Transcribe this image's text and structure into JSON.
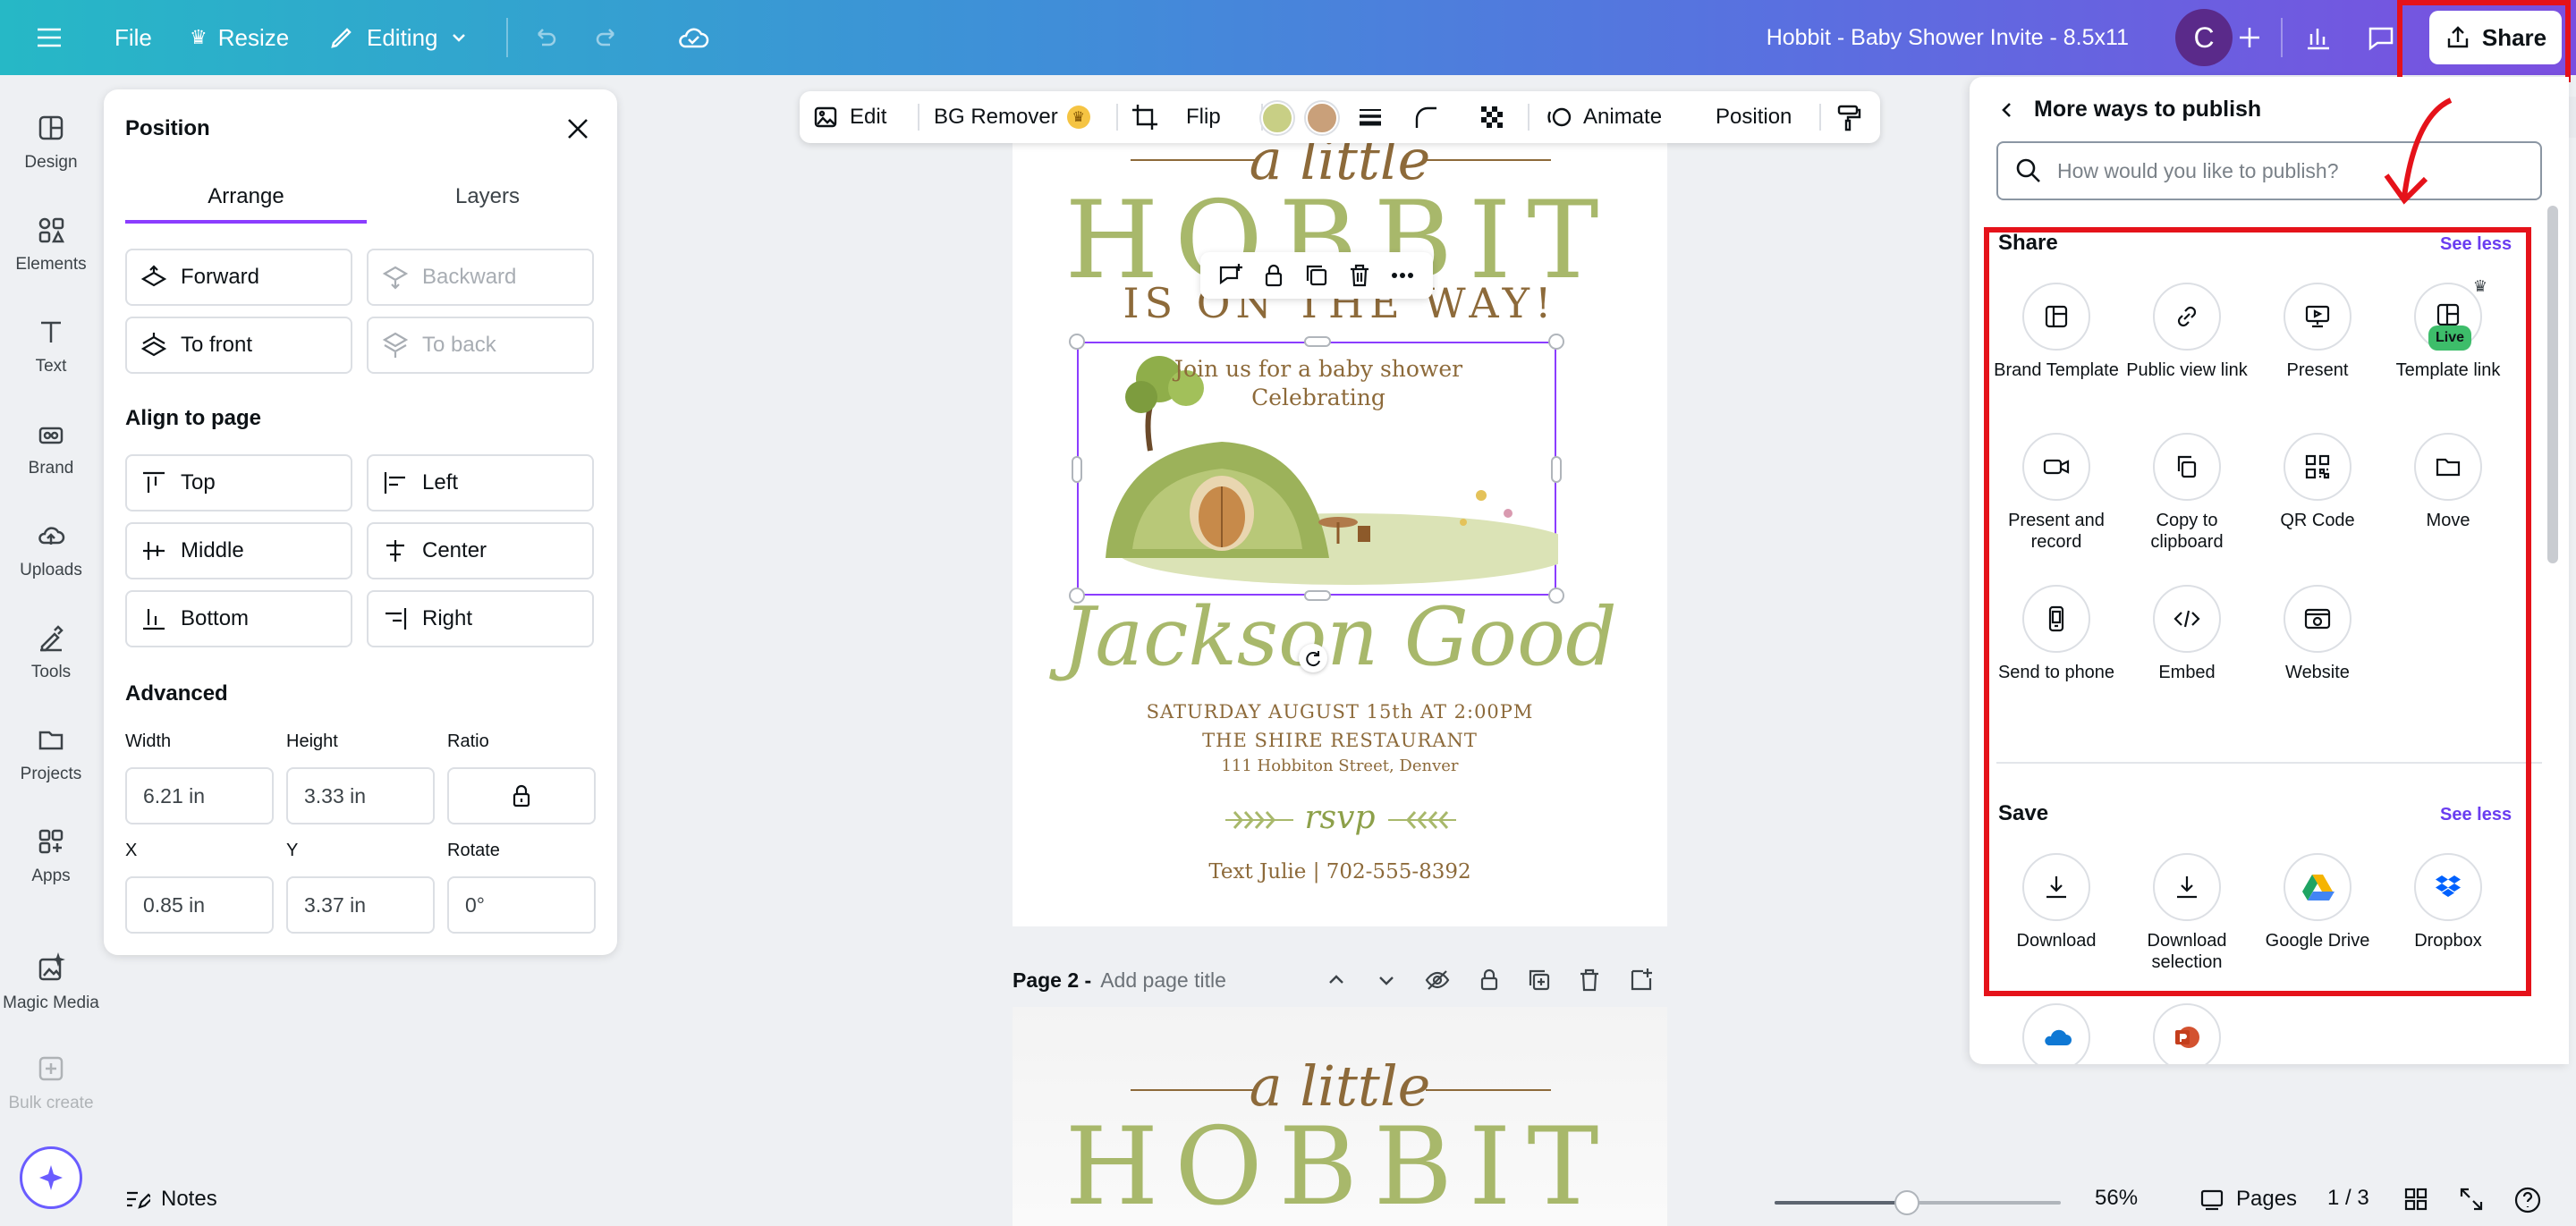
{
  "topbar": {
    "file": "File",
    "resize": "Resize",
    "editing": "Editing",
    "doc_title": "Hobbit - Baby Shower Invite - 8.5x11",
    "avatar_initial": "C",
    "share": "Share"
  },
  "rail": {
    "items": [
      {
        "label": "Design",
        "icon": "design-icon"
      },
      {
        "label": "Elements",
        "icon": "elements-icon"
      },
      {
        "label": "Text",
        "icon": "text-icon"
      },
      {
        "label": "Brand",
        "icon": "brand-icon"
      },
      {
        "label": "Uploads",
        "icon": "uploads-icon"
      },
      {
        "label": "Tools",
        "icon": "tools-icon"
      },
      {
        "label": "Projects",
        "icon": "projects-icon"
      },
      {
        "label": "Apps",
        "icon": "apps-icon"
      },
      {
        "label": "Magic Media",
        "icon": "magic-media-icon"
      },
      {
        "label": "Bulk create",
        "icon": "bulk-create-icon"
      }
    ]
  },
  "position_panel": {
    "title": "Position",
    "tabs": [
      "Arrange",
      "Layers"
    ],
    "forward": "Forward",
    "backward": "Backward",
    "to_front": "To front",
    "to_back": "To back",
    "align_title": "Align to page",
    "top": "Top",
    "left": "Left",
    "middle": "Middle",
    "center": "Center",
    "bottom": "Bottom",
    "right": "Right",
    "advanced_title": "Advanced",
    "width_label": "Width",
    "height_label": "Height",
    "ratio_label": "Ratio",
    "width": "6.21 in",
    "height": "3.33 in",
    "x_label": "X",
    "y_label": "Y",
    "rotate_label": "Rotate",
    "x": "0.85 in",
    "y": "3.37 in",
    "rotate": "0°"
  },
  "element_toolbar": {
    "edit": "Edit",
    "bg_remover": "BG Remover",
    "flip": "Flip",
    "animate": "Animate",
    "position": "Position",
    "swatch1": "#c8cf85",
    "swatch2": "#c9a07a"
  },
  "page1": {
    "a_little": "a little",
    "hobbit": "HOBBIT",
    "on_the_way": "IS ON THE WAY!",
    "join": "Join us for a baby shower",
    "celebrating": "Celebrating",
    "name": "Jackson Good",
    "date": "SATURDAY AUGUST 15th AT 2:00PM",
    "venue": "THE SHIRE RESTAURANT",
    "address": "111 Hobbiton Street, Denver",
    "rsvp": "rsvp",
    "contact": "Text Julie | 702-555-8392"
  },
  "page2": {
    "label": "Page 2 -",
    "placeholder": "Add page title",
    "a_little": "a little",
    "hobbit": "HOBBIT"
  },
  "publish_panel": {
    "title": "More ways to publish",
    "search_placeholder": "How would you like to publish?",
    "share_title": "Share",
    "see_less": "See less",
    "share_options": [
      {
        "label": "Brand Template",
        "icon": "brand-template-icon"
      },
      {
        "label": "Public view link",
        "icon": "link-icon"
      },
      {
        "label": "Present",
        "icon": "present-icon"
      },
      {
        "label": "Template link",
        "icon": "template-link-icon",
        "badge": "Live"
      },
      {
        "label": "Present and record",
        "icon": "record-icon"
      },
      {
        "label": "Copy to clipboard",
        "icon": "copy-icon"
      },
      {
        "label": "QR Code",
        "icon": "qr-code-icon"
      },
      {
        "label": "Move",
        "icon": "folder-icon"
      },
      {
        "label": "Send to phone",
        "icon": "phone-icon"
      },
      {
        "label": "Embed",
        "icon": "embed-icon"
      },
      {
        "label": "Website",
        "icon": "website-icon"
      }
    ],
    "save_title": "Save",
    "save_options": [
      {
        "label": "Download",
        "icon": "download-icon"
      },
      {
        "label": "Download selection",
        "icon": "download-selection-icon"
      },
      {
        "label": "Google Drive",
        "icon": "google-drive-icon"
      },
      {
        "label": "Dropbox",
        "icon": "dropbox-icon"
      }
    ]
  },
  "bottombar": {
    "notes": "Notes",
    "zoom": "56%",
    "zoom_level": 0.56,
    "pages": "Pages",
    "page_count": "1 / 3"
  },
  "colors": {
    "accent": "#8b3dff",
    "annotation": "#e5121a",
    "olive": "#a8b86b",
    "brown": "#8d6a3a"
  }
}
